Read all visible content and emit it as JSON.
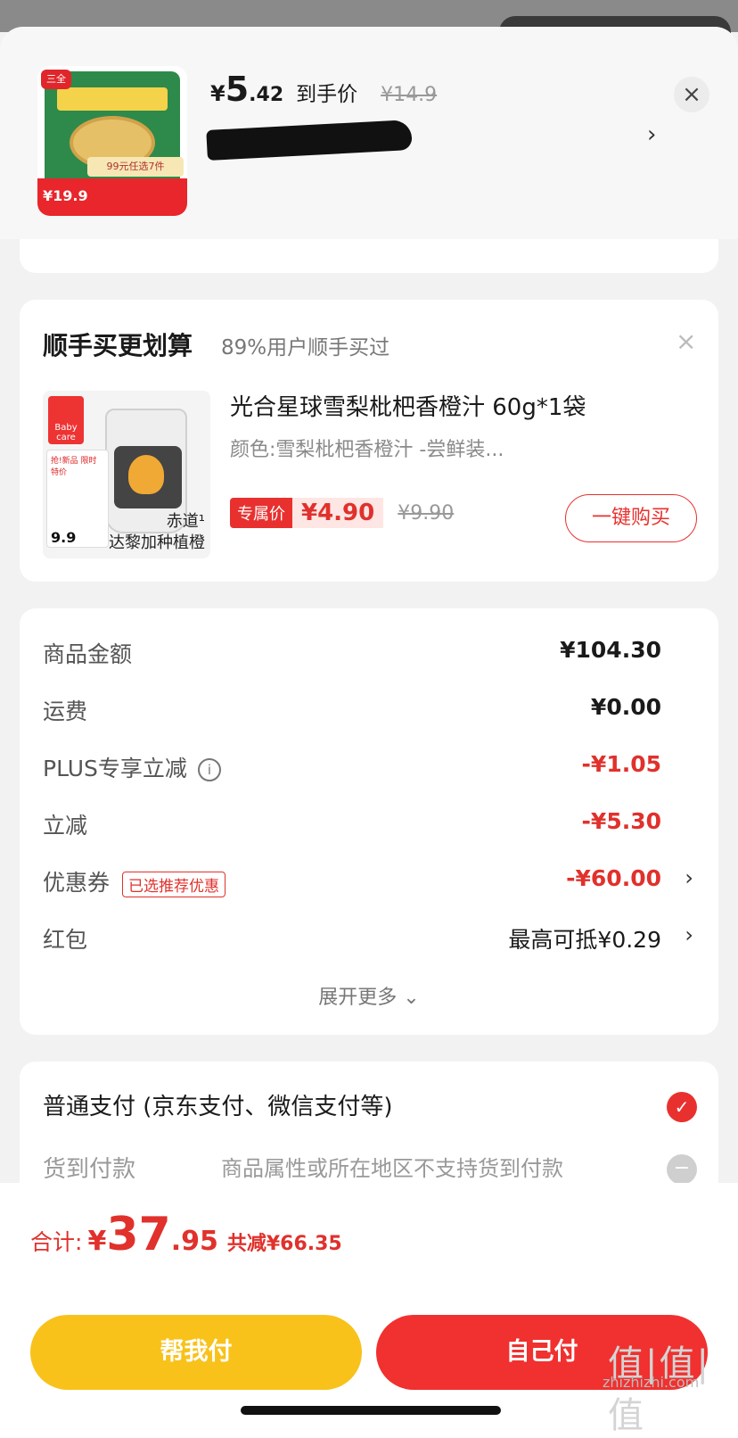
{
  "header_product": {
    "price_yen": "¥",
    "price_int": "5",
    "price_dec": ".42",
    "price_label": "到手价",
    "original_price": "¥14.9",
    "thumb_logo": "三全",
    "thumb_tag": "99元任选7件",
    "thumb_price": "¥19.9",
    "arrow": "›",
    "close": "×"
  },
  "upsell": {
    "title": "顺手买更划算",
    "subtitle": "89%用户顺手买过",
    "close": "×",
    "product_name": "光合星球雪梨枇杷香橙汁 60g*1袋",
    "attr": "颜色:雪梨枇杷香橙汁 -尝鲜装...",
    "badge": "专属价",
    "price": "¥4.90",
    "original_price": "¥9.90",
    "buy_button": "一键购买",
    "img_brand": "Baby care",
    "img_ad": "抢!新品 限时特价",
    "img_ad_price": "9.9",
    "img_caption1": "赤道¹",
    "img_caption2": "达黎加种植橙"
  },
  "summary": {
    "rows": [
      {
        "label": "商品金额",
        "value": "¥104.30"
      },
      {
        "label": "运费",
        "value": "¥0.00"
      },
      {
        "label": "PLUS专享立减",
        "value": "-¥1.05"
      },
      {
        "label": "立减",
        "value": "-¥5.30"
      },
      {
        "label": "优惠券",
        "tag": "已选推荐优惠",
        "value": "-¥60.00"
      },
      {
        "label": "红包",
        "value": "最高可抵¥0.29"
      }
    ],
    "info_icon": "i",
    "chevron": "›",
    "expand": "展开更多 ⌄"
  },
  "payment": {
    "option1": "普通支付 (京东支付、微信支付等)",
    "option2": "货到付款",
    "option2_note": "商品属性或所在地区不支持货到付款",
    "check": "✓",
    "minus": "−"
  },
  "footer": {
    "total_label": "合计:",
    "total_yen": "¥",
    "total_int": "37",
    "total_dec": ".95",
    "saved": "共减¥66.35",
    "help_pay": "帮我付",
    "self_pay": "自己付"
  },
  "watermark": {
    "logo": "值|值|值",
    "site": "zhizhizhi.com"
  },
  "colors": {
    "accent_red": "#e0312c",
    "help_yellow": "#f8c21b",
    "pay_red": "#f0312f"
  }
}
